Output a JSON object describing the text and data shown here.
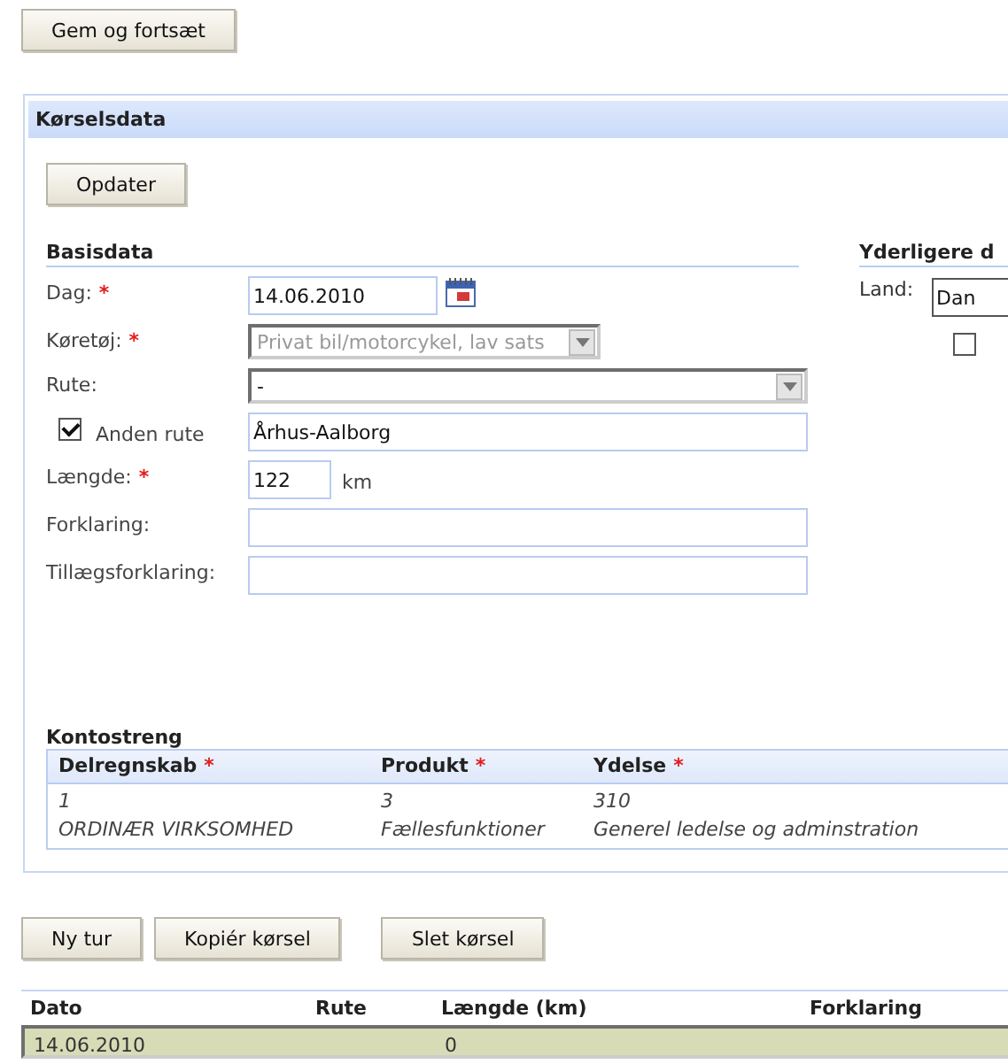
{
  "top_button": "Gem og fortsæt",
  "panel": {
    "title": "Kørselsdata",
    "update_button": "Opdater",
    "basis": {
      "title": "Basisdata",
      "fields": [
        {
          "kind": "date",
          "label": "Dag:",
          "required_mark": "*",
          "value": "14.06.2010"
        },
        {
          "kind": "select",
          "label": "Køretøj:",
          "required_mark": "*",
          "value": "Privat bil/motorcykel, lav sats",
          "disabled": true
        },
        {
          "kind": "select",
          "label": "Rute:",
          "value": "-",
          "disabled": false
        },
        {
          "kind": "check-text",
          "label": "Anden rute",
          "checked": true,
          "value": "Århus-Aalborg"
        },
        {
          "kind": "number",
          "label": "Længde:",
          "required_mark": "*",
          "value": "122",
          "unit": "km"
        },
        {
          "kind": "text",
          "label": "Forklaring:"
        },
        {
          "kind": "text",
          "label": "Tillægsforklaring:"
        }
      ]
    },
    "extra": {
      "title": "Yderligere d",
      "land_label": "Land:",
      "land_value": "Dan",
      "checked": false
    },
    "account": {
      "title": "Kontostreng",
      "columns": [
        {
          "label": "Delregnskab",
          "required_mark": "*"
        },
        {
          "label": "Produkt",
          "required_mark": "*"
        },
        {
          "label": "Ydelse",
          "required_mark": "*"
        }
      ],
      "codes": [
        "1",
        "3",
        "310"
      ],
      "names": [
        "ORDINÆR VIRKSOMHED",
        "Fællesfunktioner",
        "Generel ledelse og adminstration"
      ]
    }
  },
  "actions": [
    "Ny tur",
    "Kopiér kørsel",
    "Slet kørsel"
  ],
  "trips": {
    "columns": [
      "Dato",
      "Rute",
      "Længde (km)",
      "Forklaring"
    ],
    "rows": [
      {
        "selected": true,
        "cells": [
          "14.06.2010",
          "",
          "0",
          ""
        ]
      }
    ]
  }
}
